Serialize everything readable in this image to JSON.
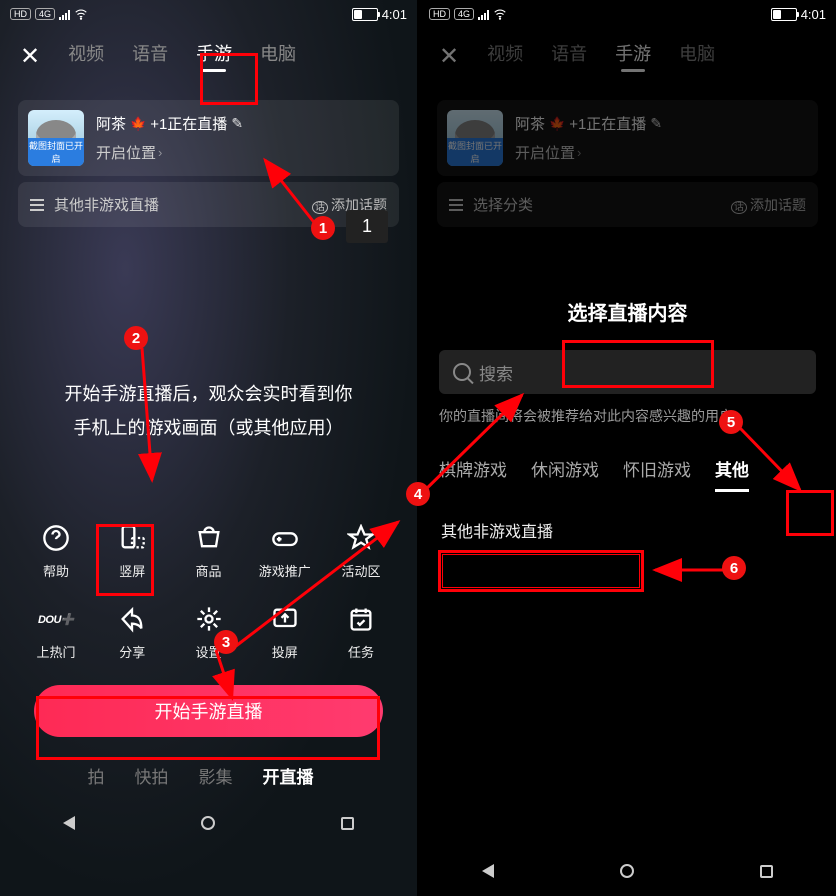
{
  "statusbar": {
    "hd": "HD",
    "net": "4G",
    "time": "4:01"
  },
  "tabs": {
    "video": "视频",
    "voice": "语音",
    "mobile": "手游",
    "pc": "电脑"
  },
  "card": {
    "avatar_badge": "截图封面已开启",
    "title": "阿茶",
    "title_suffix": "+1正在直播",
    "open_pos": "开启位置"
  },
  "catrow_left": {
    "label": "其他非游戏直播",
    "add": "添加话题"
  },
  "catrow_right": {
    "label": "选择分类",
    "add": "添加话题"
  },
  "center_text": {
    "l1": "开始手游直播后，观众会实时看到你",
    "l2": "手机上的游戏画面（或其他应用）"
  },
  "tools": {
    "help": "帮助",
    "portrait": "竖屏",
    "shop": "商品",
    "gamepromo": "游戏推广",
    "activity": "活动区",
    "hot": "上热门",
    "dou": "DOU➕",
    "share": "分享",
    "settings": "设置",
    "cast": "投屏",
    "task": "任务"
  },
  "cta": "开始手游直播",
  "bottom_tabs": {
    "suipai": "拍",
    "kuaipai": "快拍",
    "album": "影集",
    "live": "开直播"
  },
  "right": {
    "sheet_title": "选择直播内容",
    "search_ph": "搜索",
    "hint": "你的直播间将会被推荐给对此内容感兴趣的用户",
    "cats": {
      "board": "棋牌游戏",
      "casual": "休闲游戏",
      "retro": "怀旧游戏",
      "other": "其他"
    },
    "other_link": "其他非游戏直播"
  },
  "anno": {
    "n1": "1",
    "n2": "2",
    "n3": "3",
    "n4": "4",
    "n5": "5",
    "n6": "6",
    "tip1": "1"
  }
}
